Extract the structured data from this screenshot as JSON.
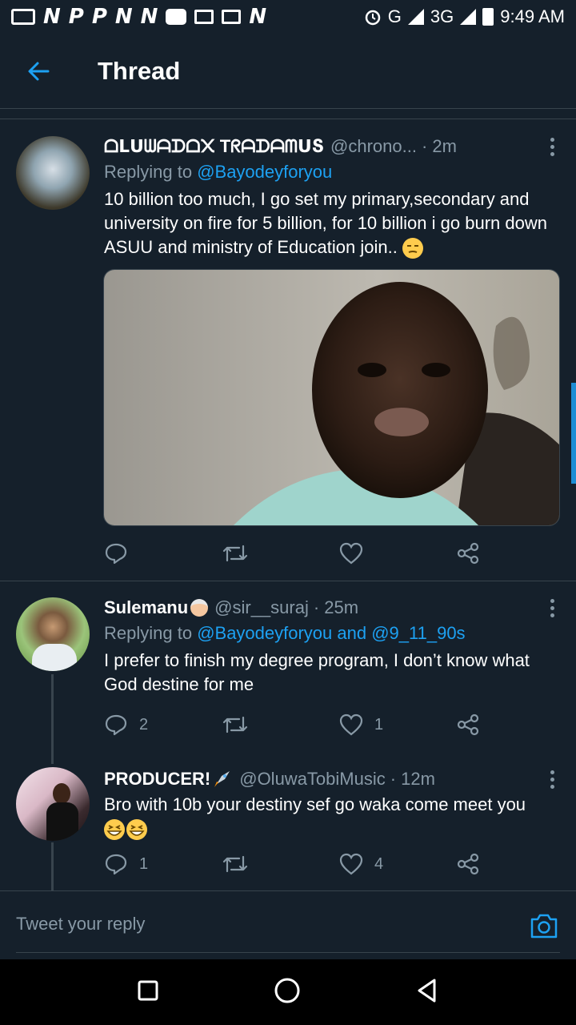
{
  "status_bar": {
    "time": "9:49 AM",
    "network": "G",
    "network2": "3G",
    "notif_glyphs": [
      "N",
      "P",
      "P",
      "N",
      "N",
      "N"
    ]
  },
  "header": {
    "title": "Thread",
    "back_icon": "arrow-left-icon"
  },
  "tweets": [
    {
      "name": "ᗝᒪᑌᗯᗩᗪᗝ᙭ TᖇᗩᗪᗩᗰᑌՏ",
      "handle": "@chrono...",
      "time": "· 2m",
      "replying_prefix": "Replying to ",
      "replying_to": "@Bayodeyforyou",
      "text": "10 billion too much, I go set my primary,secondary and university on fire for 5 billion, for 10 billion i go burn down ASUU and ministry of Education join..",
      "emoji": "unamused-face",
      "has_media": true,
      "counts": {
        "reply": "",
        "retweet": "",
        "like": ""
      }
    },
    {
      "name": "Sulemanu",
      "name_emoji": "old-man",
      "handle": "@sir__suraj",
      "time": "· 25m",
      "replying_prefix": "Replying to ",
      "replying_to": "@Bayodeyforyou and @9_11_90s",
      "text": "I prefer to finish my degree program, I don’t know what God destine for me",
      "counts": {
        "reply": "2",
        "retweet": "",
        "like": "1"
      }
    },
    {
      "name": "PRODUCER!",
      "name_emoji": "rocket",
      "handle": "@OluwaTobiMusic",
      "time": "· 12m",
      "text": "Bro with 10b your destiny sef go waka come meet you",
      "text_emoji": "grinning-squinting-face",
      "counts": {
        "reply": "1",
        "retweet": "",
        "like": "4"
      }
    }
  ],
  "reply_bar": {
    "placeholder": "Tweet your reply",
    "icon": "camera-icon"
  },
  "nav_bar": {
    "icons": [
      "recents-square-icon",
      "home-circle-icon",
      "back-triangle-icon"
    ]
  },
  "colors": {
    "background": "#15202b",
    "accent": "#1da1f2",
    "muted": "#8899a6",
    "divider": "#38444d"
  }
}
